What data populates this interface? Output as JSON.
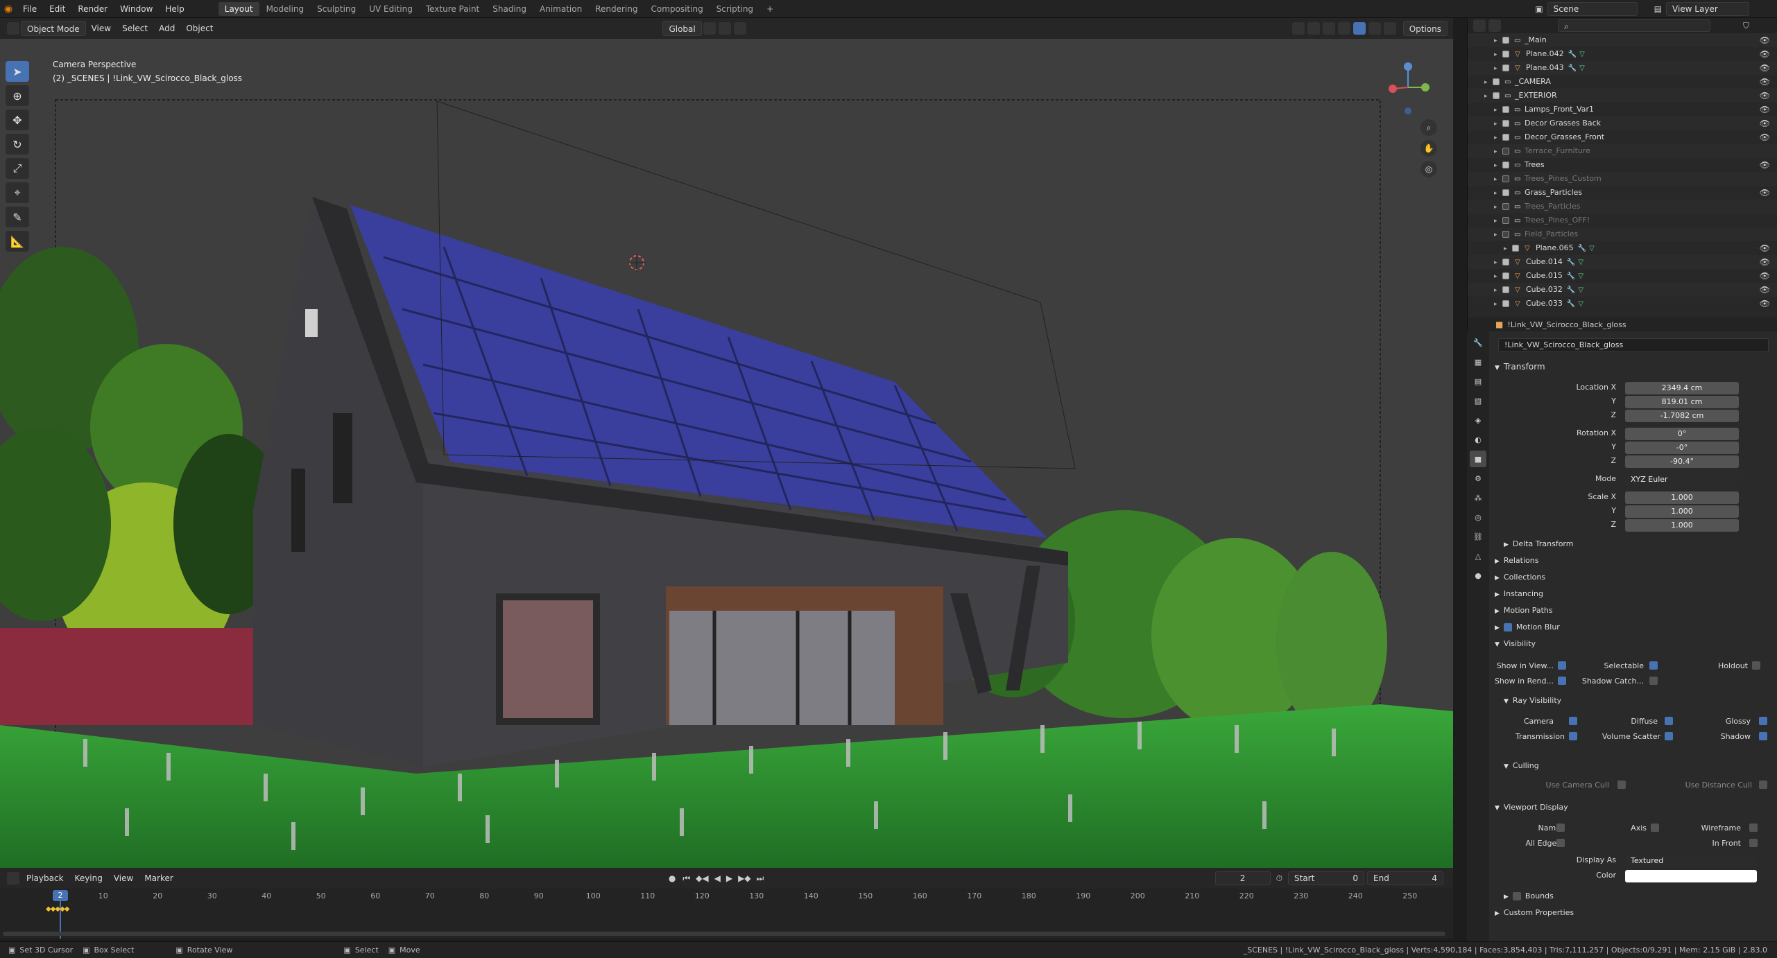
{
  "topbar": {
    "menus": [
      "File",
      "Edit",
      "Render",
      "Window",
      "Help"
    ],
    "workspaces": [
      "Layout",
      "Modeling",
      "Sculpting",
      "UV Editing",
      "Texture Paint",
      "Shading",
      "Animation",
      "Rendering",
      "Compositing",
      "Scripting"
    ],
    "active_workspace": "Layout",
    "scene_name": "Scene",
    "view_layer": "View Layer"
  },
  "viewport_header": {
    "mode": "Object Mode",
    "menus": [
      "View",
      "Select",
      "Add",
      "Object"
    ],
    "orientation": "Global",
    "options": "Options"
  },
  "viewport": {
    "camera_label": "Camera Perspective",
    "object_label": "(2) _SCENES | !Link_VW_Scirocco_Black_gloss"
  },
  "outliner": {
    "rows": [
      {
        "name": "_Main",
        "type": "collection",
        "indent": 2,
        "dim": false
      },
      {
        "name": "Plane.042",
        "type": "object",
        "indent": 2,
        "dim": false
      },
      {
        "name": "Plane.043",
        "type": "object",
        "indent": 2,
        "dim": false
      },
      {
        "name": "_CAMERA",
        "type": "collection",
        "indent": 1,
        "dim": false
      },
      {
        "name": "_EXTERIOR",
        "type": "collection",
        "indent": 1,
        "dim": false
      },
      {
        "name": "Lamps_Front_Var1",
        "type": "collection",
        "indent": 2,
        "dim": false
      },
      {
        "name": "Decor Grasses Back",
        "type": "collection",
        "indent": 2,
        "dim": false
      },
      {
        "name": "Decor_Grasses_Front",
        "type": "collection",
        "indent": 2,
        "dim": false
      },
      {
        "name": "Terrace_Furniture",
        "type": "collection",
        "indent": 2,
        "dim": true
      },
      {
        "name": "Trees",
        "type": "collection",
        "indent": 2,
        "dim": false
      },
      {
        "name": "Trees_Pines_Custom",
        "type": "collection",
        "indent": 2,
        "dim": true
      },
      {
        "name": "Grass_Particles",
        "type": "collection",
        "indent": 2,
        "dim": false
      },
      {
        "name": "Trees_Particles",
        "type": "collection",
        "indent": 2,
        "dim": true
      },
      {
        "name": "Trees_Pines_OFF!",
        "type": "collection",
        "indent": 2,
        "dim": true
      },
      {
        "name": "Field_Particles",
        "type": "collection",
        "indent": 2,
        "dim": true
      },
      {
        "name": "Plane.065",
        "type": "object",
        "indent": 3,
        "dim": false
      },
      {
        "name": "Cube.014",
        "type": "object",
        "indent": 2,
        "dim": false
      },
      {
        "name": "Cube.015",
        "type": "object",
        "indent": 2,
        "dim": false
      },
      {
        "name": "Cube.032",
        "type": "object",
        "indent": 2,
        "dim": false
      },
      {
        "name": "Cube.033",
        "type": "object",
        "indent": 2,
        "dim": false
      }
    ]
  },
  "properties": {
    "object_name": "!Link_VW_Scirocco_Black_gloss",
    "object_field": "!Link_VW_Scirocco_Black_gloss",
    "transform": {
      "title": "Transform",
      "location_label": "Location X",
      "location": [
        "2349.4 cm",
        "819.01 cm",
        "-1.7082 cm"
      ],
      "rotation_label": "Rotation X",
      "rotation": [
        "0°",
        "-0°",
        "-90.4°"
      ],
      "mode_label": "Mode",
      "mode": "XYZ Euler",
      "scale_label": "Scale X",
      "scale": [
        "1.000",
        "1.000",
        "1.000"
      ],
      "y": "Y",
      "z": "Z"
    },
    "sections": [
      "Delta Transform",
      "Relations",
      "Collections",
      "Instancing",
      "Motion Paths",
      "Motion Blur",
      "Visibility"
    ],
    "visibility": {
      "show_in_viewport": "Show in View...",
      "selectable": "Selectable",
      "holdout": "Holdout",
      "show_in_render": "Show in Rend...",
      "shadow_catcher": "Shadow Catch...",
      "ray_visibility": "Ray Visibility",
      "camera": "Camera",
      "diffuse": "Diffuse",
      "glossy": "Glossy",
      "transmission": "Transmission",
      "volume_scatter": "Volume Scatter",
      "shadow": "Shadow",
      "culling": "Culling",
      "use_camera_cull": "Use Camera Cull",
      "use_distance_cull": "Use Distance Cull"
    },
    "viewport_display": {
      "title": "Viewport Display",
      "name": "Name",
      "axis": "Axis",
      "wireframe": "Wireframe",
      "all_edges": "All Edges",
      "in_front": "In Front",
      "display_as_label": "Display As",
      "display_as": "Textured",
      "color_label": "Color",
      "bounds": "Bounds"
    },
    "custom_properties": "Custom Properties"
  },
  "timeline": {
    "menus": [
      "Playback",
      "Keying",
      "View",
      "Marker"
    ],
    "current_frame": "2",
    "start_label": "Start",
    "start": "0",
    "end_label": "End",
    "end": "4",
    "ticks": [
      "10",
      "20",
      "30",
      "40",
      "50",
      "60",
      "70",
      "80",
      "90",
      "100",
      "110",
      "120",
      "130",
      "140",
      "150",
      "160",
      "170",
      "180",
      "190",
      "200",
      "210",
      "220",
      "230",
      "240",
      "250"
    ]
  },
  "statusbar": {
    "set_cursor": "Set 3D Cursor",
    "box_select": "Box Select",
    "rotate_view": "Rotate View",
    "select": "Select",
    "move": "Move",
    "stats": "_SCENES | !Link_VW_Scirocco_Black_gloss | Verts:4,590,184 | Faces:3,854,403 | Tris:7,111,257 | Objects:0/9,291 | Mem: 2.15 GiB | 2.83.0"
  },
  "colors": {
    "accent": "#4772b3",
    "solar": "#3a3f9e",
    "grass": "#2f8f2f",
    "wall": "#3a393c"
  }
}
